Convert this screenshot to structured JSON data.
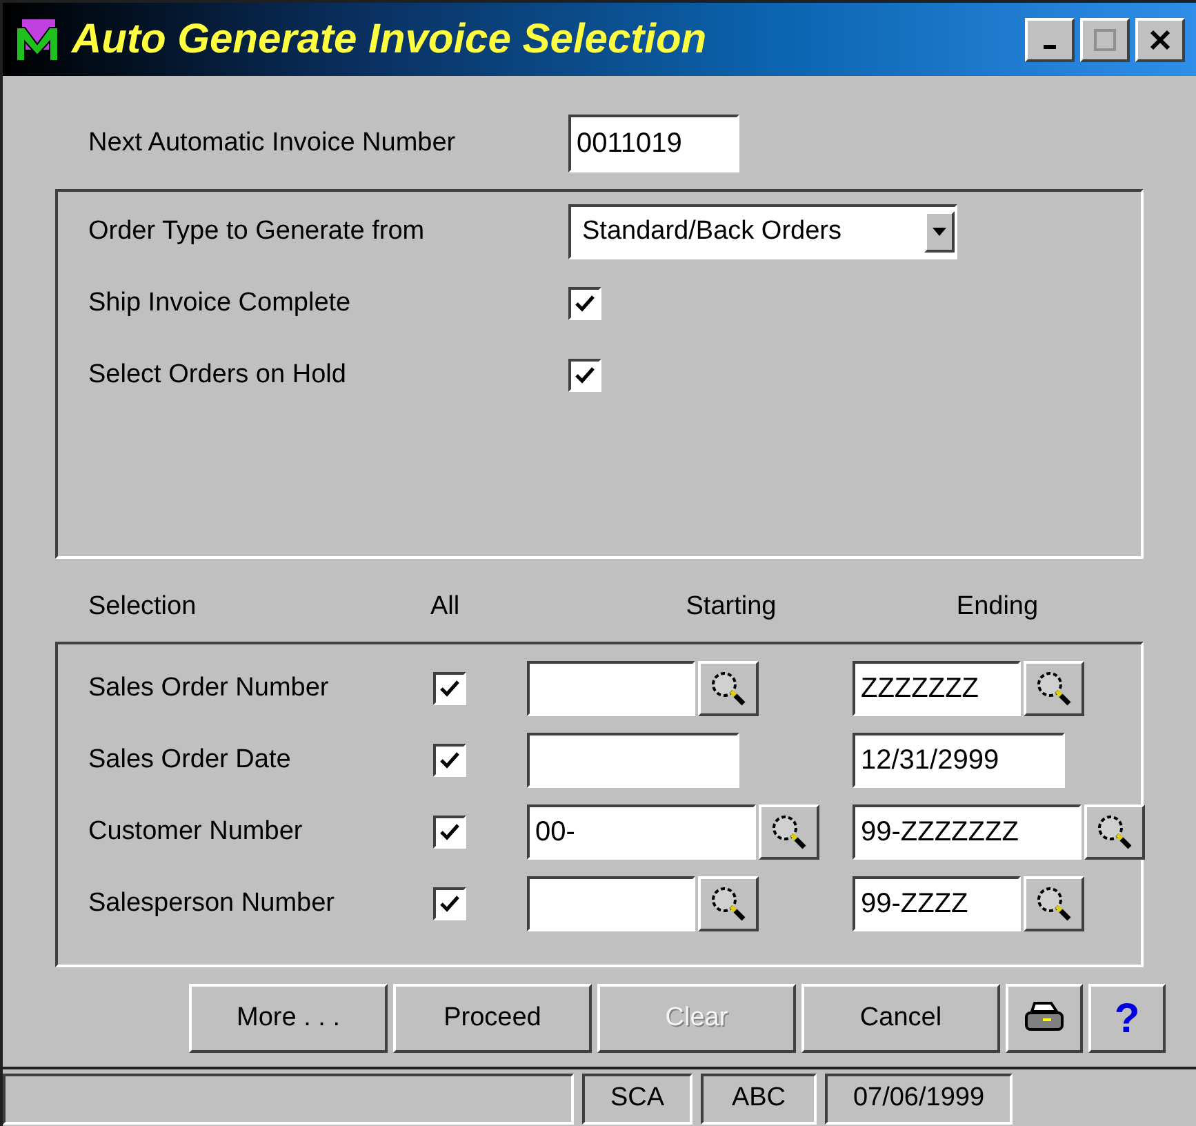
{
  "window": {
    "title": "Auto Generate Invoice Selection"
  },
  "next_invoice": {
    "label": "Next Automatic Invoice Number",
    "value": "0011019"
  },
  "options": [
    {
      "kind": "dropdown",
      "label": "Order Type to Generate from",
      "value": "Standard/Back Orders"
    },
    {
      "kind": "checkbox",
      "label": "Ship Invoice Complete",
      "checked": true
    },
    {
      "kind": "checkbox",
      "label": "Select Orders on Hold",
      "checked": true
    }
  ],
  "selection": {
    "columns": [
      "Selection",
      "All",
      "Starting",
      "Ending"
    ],
    "rows": [
      {
        "label": "Sales Order Number",
        "all": true,
        "starting": {
          "lookup": true
        },
        "ending": {
          "value": "ZZZZZZZ",
          "lookup": true
        }
      },
      {
        "label": "Sales Order Date",
        "all": true,
        "starting": {
          "lookup": false
        },
        "ending": {
          "value": "12/31/2999",
          "lookup": false
        }
      },
      {
        "label": "Customer Number",
        "all": true,
        "starting": {
          "value": "00-",
          "lookup": true
        },
        "ending": {
          "value": "99-ZZZZZZZ",
          "lookup": true
        }
      },
      {
        "label": "Salesperson Number",
        "all": true,
        "starting": {
          "lookup": true
        },
        "ending": {
          "value": "99-ZZZZ",
          "lookup": true
        }
      }
    ]
  },
  "buttons": [
    {
      "label": "More . . .",
      "disabled": false
    },
    {
      "label": "Proceed",
      "disabled": false
    },
    {
      "label": "Clear",
      "disabled": true
    },
    {
      "label": "Cancel",
      "disabled": false
    }
  ],
  "help_button": "?",
  "status_bar": [
    "SCA",
    "ABC",
    "07/06/1999"
  ]
}
